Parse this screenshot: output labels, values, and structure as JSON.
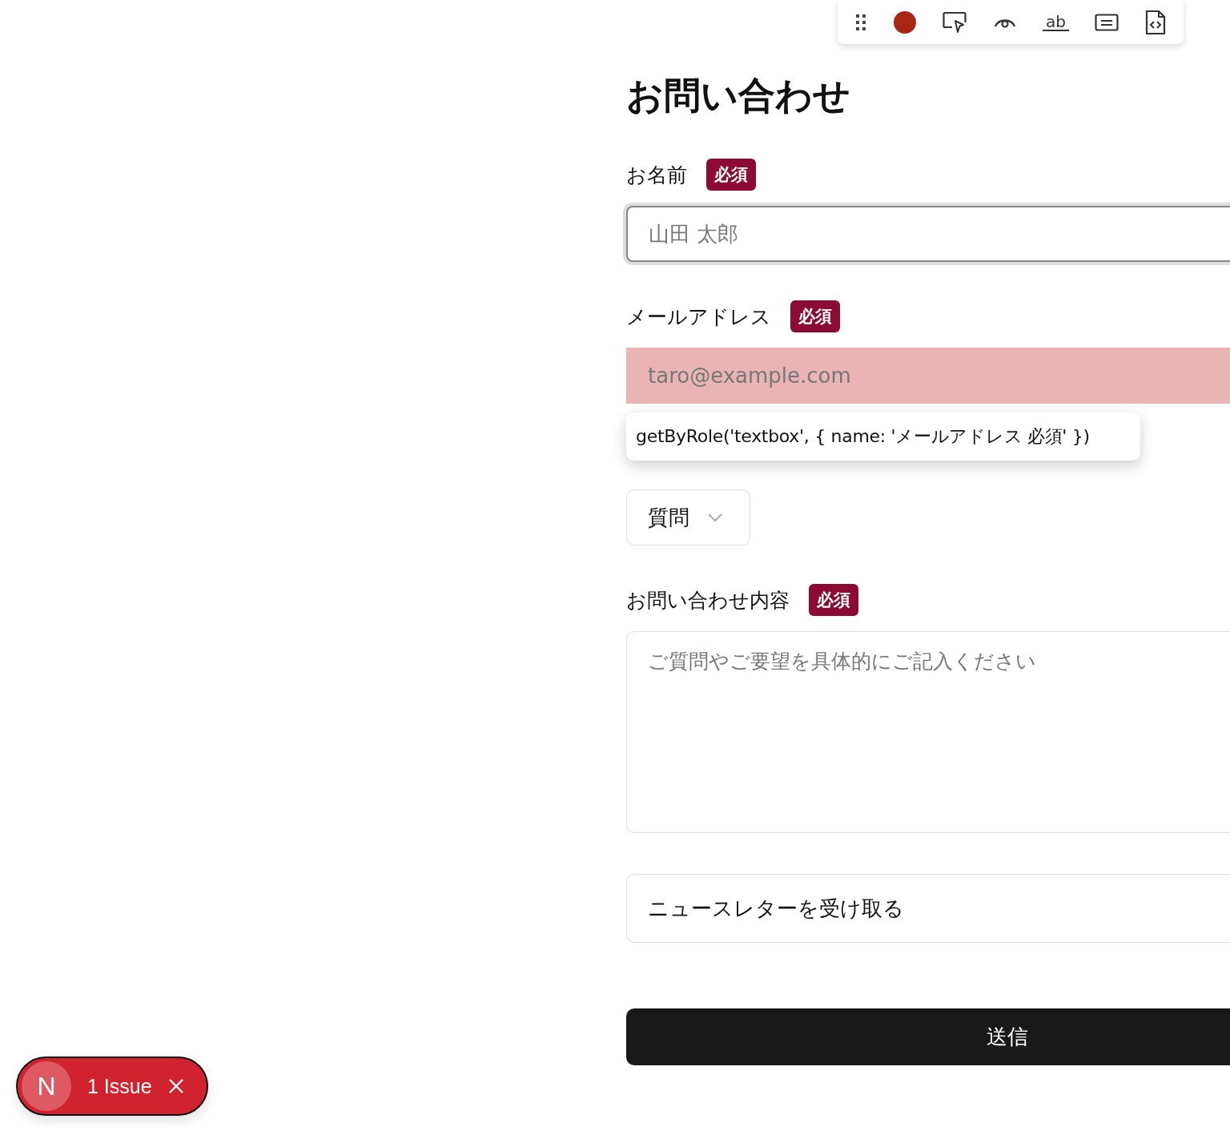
{
  "toolbar": {
    "recording": true,
    "text_tool_label": "ab"
  },
  "title": "お問い合わせ",
  "fields": [
    {
      "kind": "text",
      "label": "お名前",
      "badge": "必須",
      "placeholder": "山田 太郎",
      "focused": true,
      "highlighted": false
    },
    {
      "kind": "text",
      "label": "メールアドレス",
      "badge": "必須",
      "placeholder": "taro@example.com",
      "focused": false,
      "highlighted": true
    },
    {
      "kind": "select",
      "value": "質問"
    },
    {
      "kind": "textarea",
      "label": "お問い合わせ内容",
      "badge": "必須",
      "placeholder": "ご質問やご要望を具体的にご記入ください"
    },
    {
      "kind": "option",
      "label": "ニュースレターを受け取る"
    }
  ],
  "submit": "送信",
  "tooltip": "getByRole('textbox', { name: 'メールアドレス 必須' })",
  "issues": {
    "logo": "N",
    "label": "1 Issue"
  }
}
